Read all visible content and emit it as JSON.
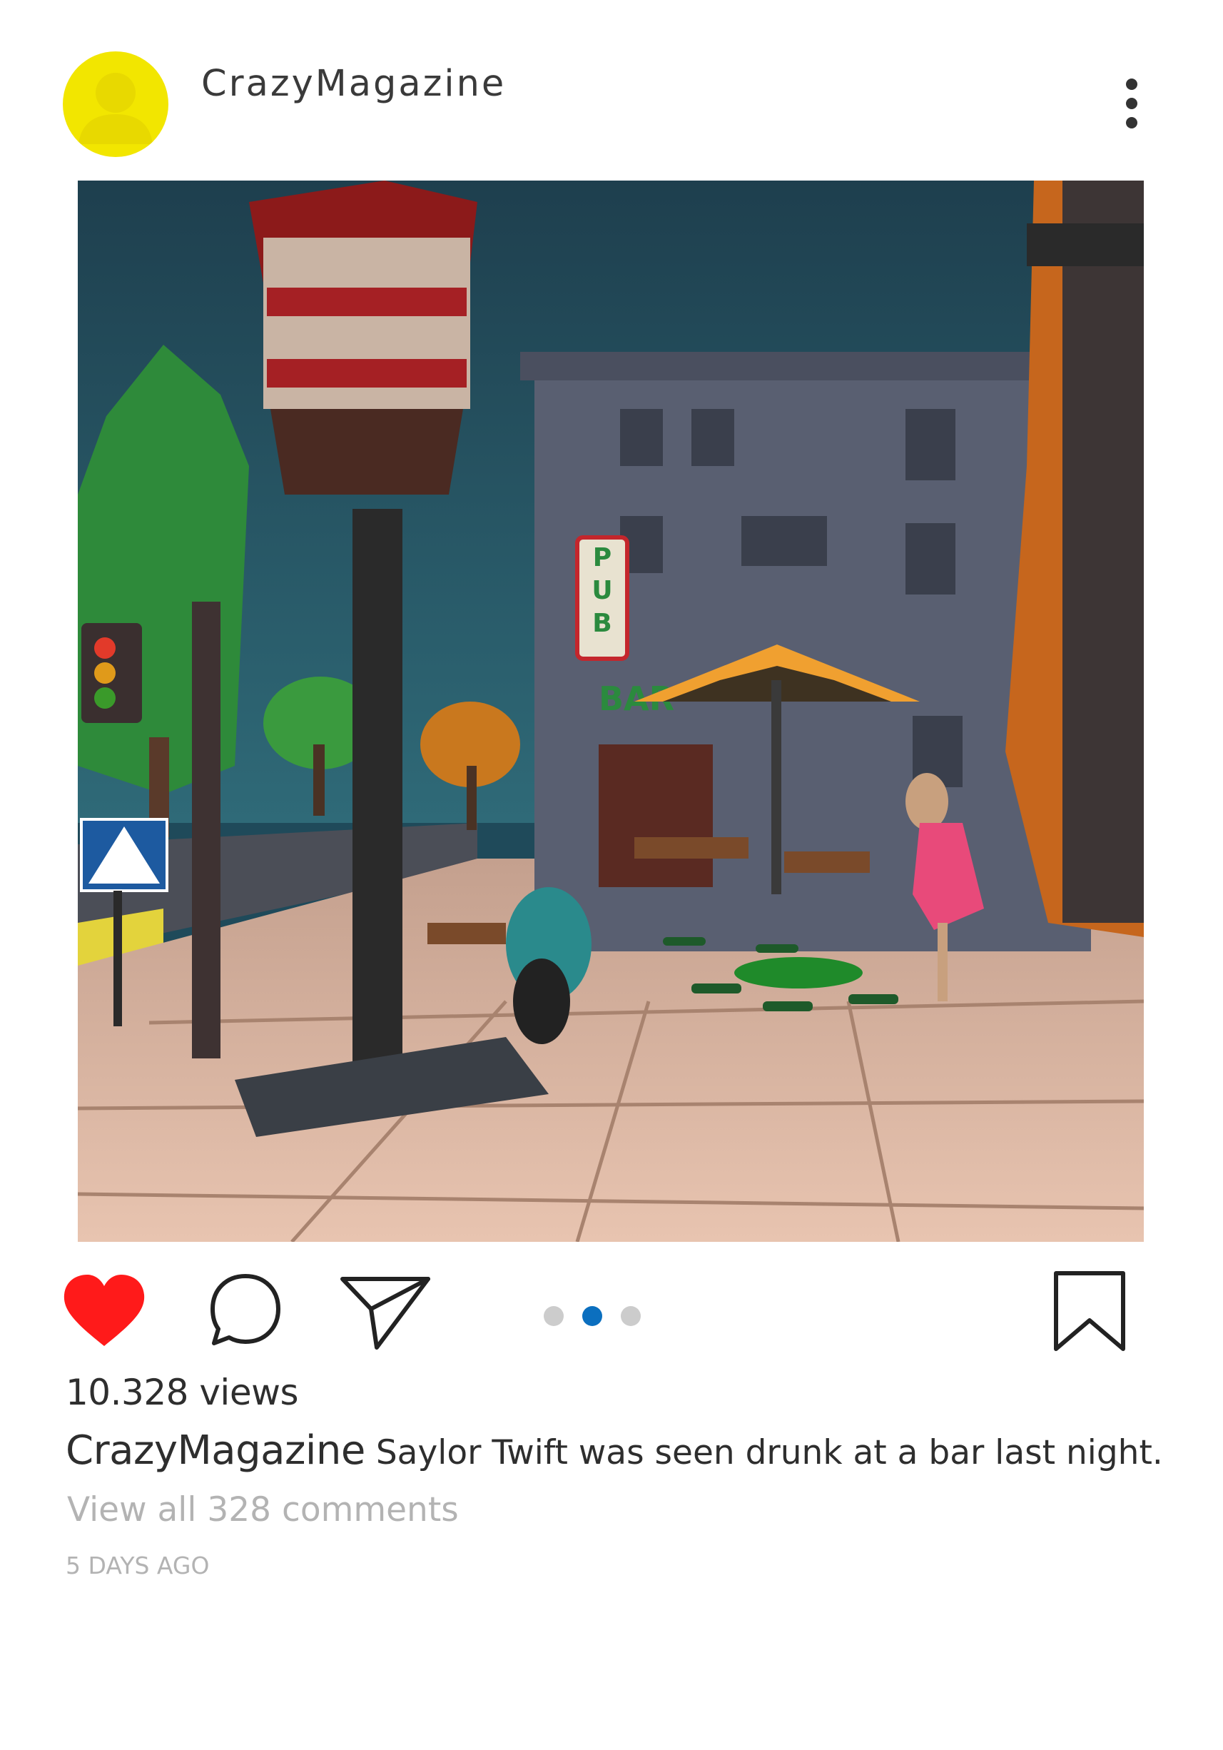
{
  "post": {
    "username": "CrazyMagazine",
    "avatar_icon": "user-placeholder-icon",
    "avatar_color": "#f2e600",
    "more_icon": "vertical-ellipsis-icon",
    "image": {
      "signs": {
        "pub": "PUB",
        "bar": "BAR"
      }
    },
    "actions": {
      "like_icon": "heart-icon",
      "like_color": "#ff1a1a",
      "comment_icon": "comment-bubble-icon",
      "share_icon": "send-icon",
      "save_icon": "bookmark-icon"
    },
    "carousel": {
      "count": 3,
      "active_index": 1,
      "active_color": "#0b6fbf",
      "inactive_color": "#cccccc"
    },
    "views": "10.328 views",
    "caption": {
      "username": "CrazyMagazine",
      "text": "Saylor Twift was seen drunk at a bar last night."
    },
    "comments_link": "View all 328 comments",
    "timestamp": "5 DAYS AGO"
  }
}
